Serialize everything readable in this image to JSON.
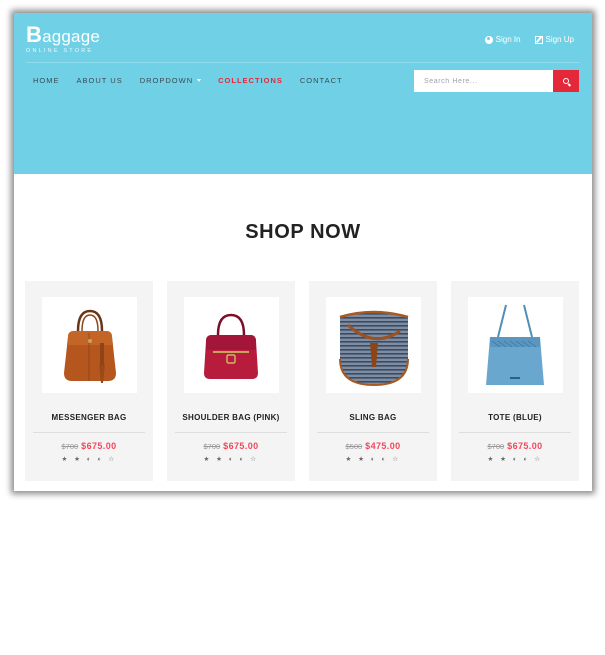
{
  "brand": {
    "initial": "B",
    "name": "aggage",
    "tagline": "ONLINE STORE"
  },
  "account": {
    "sign_in": "Sign In",
    "sign_up": "Sign Up"
  },
  "nav": {
    "items": [
      {
        "label": "HOME"
      },
      {
        "label": "ABOUT US"
      },
      {
        "label": "DROPDOWN"
      },
      {
        "label": "COLLECTIONS",
        "active": true
      },
      {
        "label": "CONTACT"
      }
    ]
  },
  "search": {
    "placeholder": "Search Here..."
  },
  "main": {
    "title": "SHOP NOW"
  },
  "products": [
    {
      "name": "MESSENGER BAG",
      "old_price": "$700",
      "price": "$675.00",
      "rating": "★ ★ ◐ ◐ ☆"
    },
    {
      "name": "SHOULDER BAG (PINK)",
      "old_price": "$700",
      "price": "$675.00",
      "rating": "★ ★ ◐ ◐ ☆"
    },
    {
      "name": "SLING BAG",
      "old_price": "$500",
      "price": "$475.00",
      "rating": "★ ★ ◐ ◐ ☆"
    },
    {
      "name": "TOTE (BLUE)",
      "old_price": "$700",
      "price": "$675.00",
      "rating": "★ ★ ◐ ◐ ☆"
    }
  ],
  "colors": {
    "header": "#70d1e6",
    "accent": "#e4283a",
    "price": "#f2475a"
  }
}
